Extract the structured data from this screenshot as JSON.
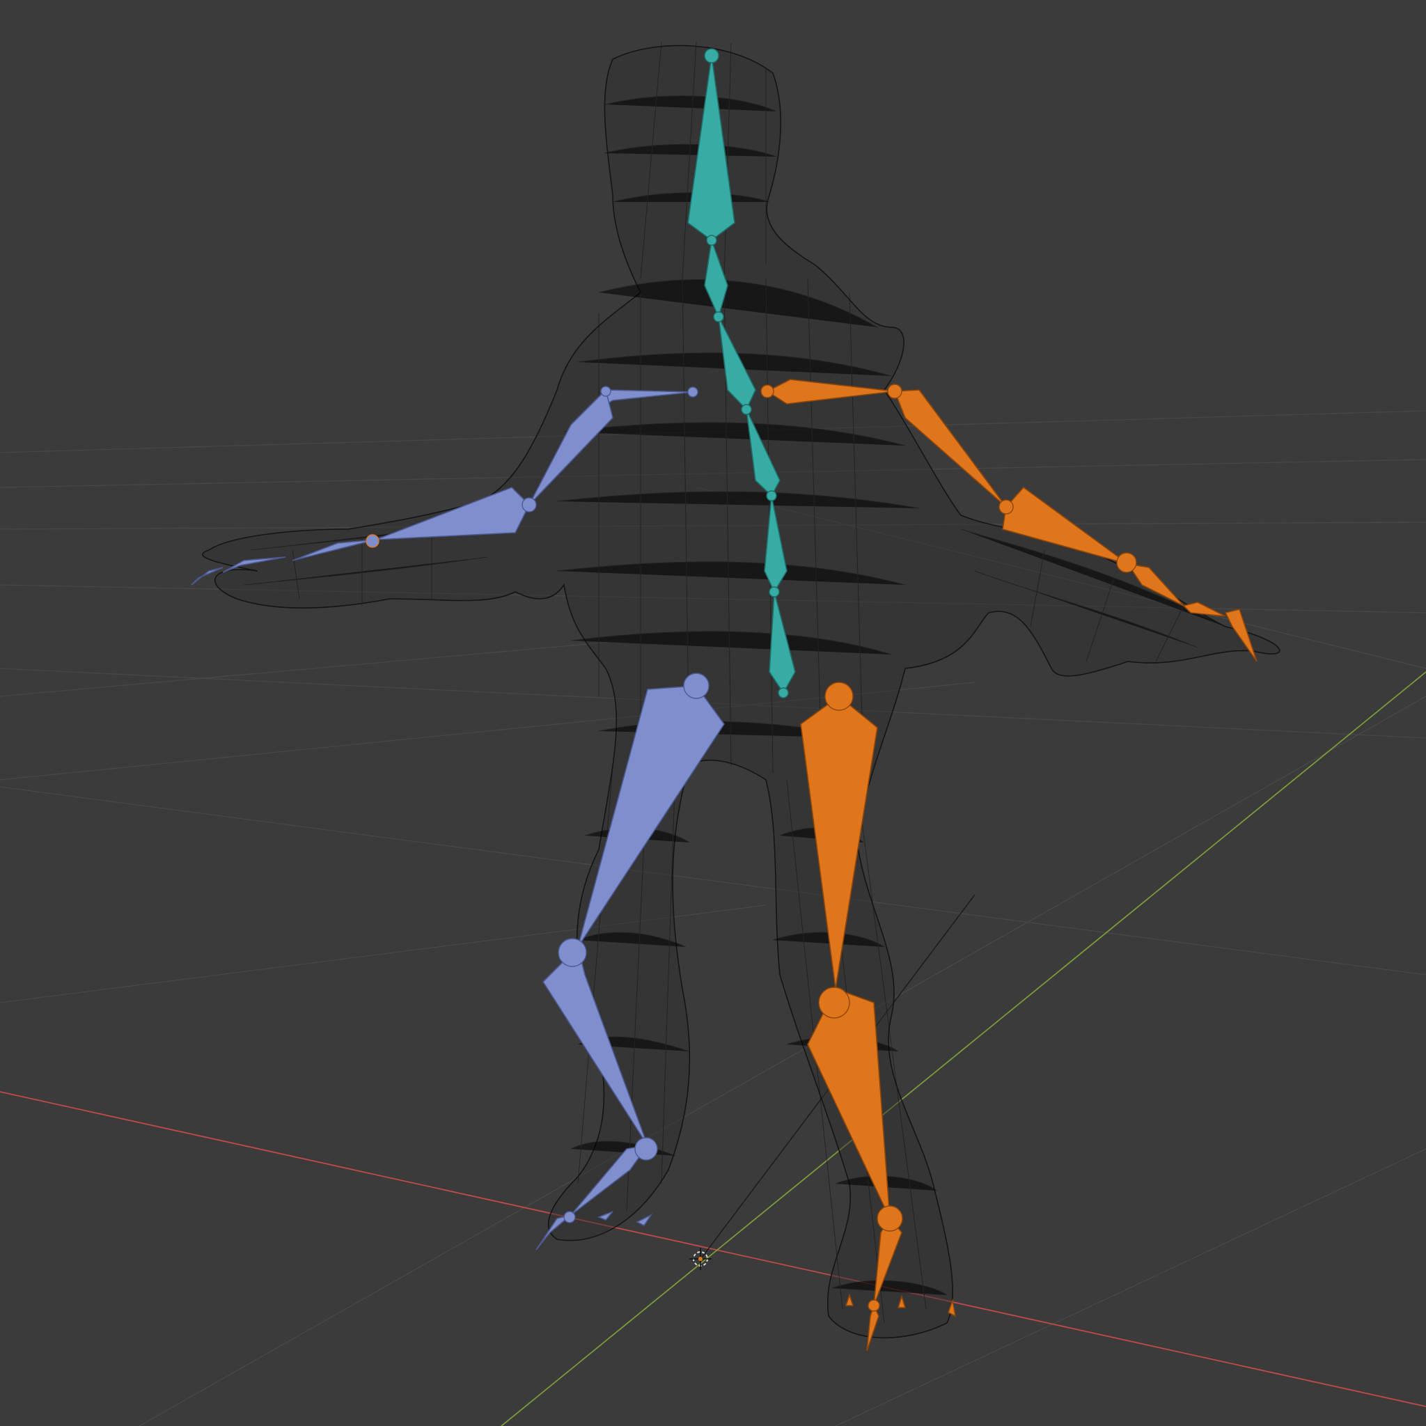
{
  "viewport": {
    "background": "#3b3b3b",
    "grid_color": "#484848",
    "axis_x_color": "#c24a4a",
    "axis_y_color": "#7c9a3a",
    "wireframe_color": "#141414"
  },
  "armature": {
    "groups": [
      {
        "name": "center",
        "color": "#36aca4",
        "stroke": "#1f6f6a"
      },
      {
        "name": "left",
        "color": "#7f8fce",
        "stroke": "#4d5a92"
      },
      {
        "name": "right",
        "color": "#e0761c",
        "stroke": "#8f4608"
      }
    ]
  },
  "objects": [
    {
      "name": "mesh-wireframe-icon"
    },
    {
      "name": "armature-icon"
    },
    {
      "name": "3d-cursor-icon"
    }
  ]
}
